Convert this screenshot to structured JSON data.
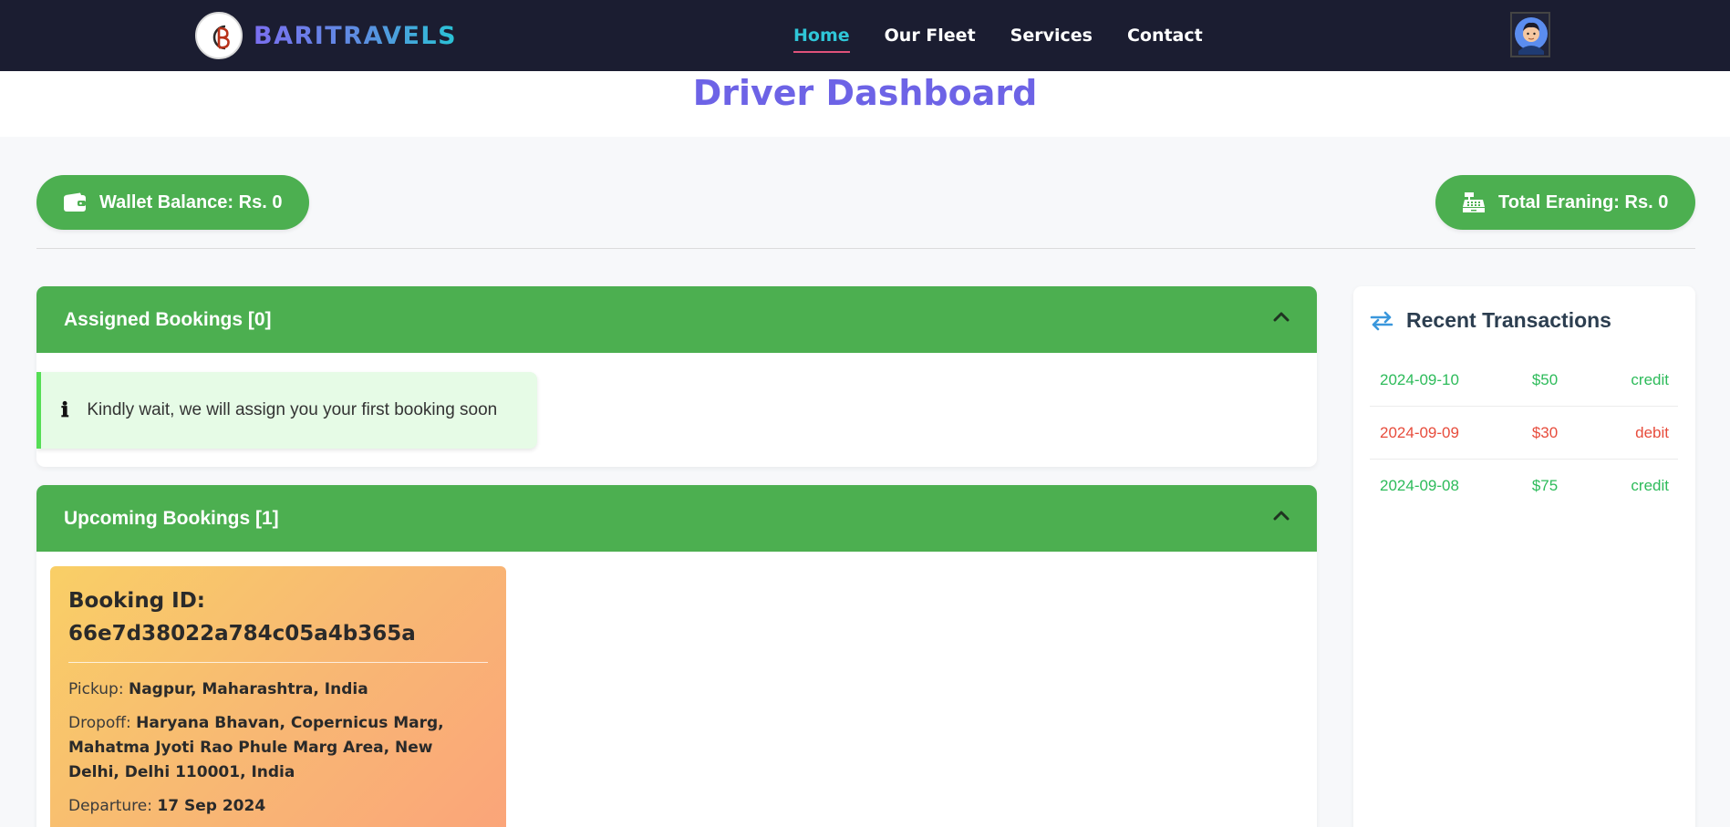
{
  "nav": {
    "brand": "BARITRAVELS",
    "links": [
      "Home",
      "Our Fleet",
      "Services",
      "Contact"
    ]
  },
  "page": {
    "title": "Driver Dashboard"
  },
  "stats": {
    "wallet": "Wallet Balance: Rs. 0",
    "earning": "Total Eraning: Rs. 0"
  },
  "assigned": {
    "header": "Assigned Bookings [0]",
    "notice": "Kindly wait, we will assign you your first booking soon",
    "notice_icon": "ℹ"
  },
  "upcoming": {
    "header": "Upcoming Bookings [1]",
    "booking": {
      "title": "Booking ID: 66e7d38022a784c05a4b365a",
      "pickup_label": "Pickup:",
      "pickup": "Nagpur, Maharashtra, India",
      "dropoff_label": "Dropoff:",
      "dropoff": "Haryana Bhavan, Copernicus Marg, Mahatma Jyoti Rao Phule Marg Area, New Delhi, Delhi 110001, India",
      "departure_label": "Departure:",
      "departure": "17 Sep 2024"
    }
  },
  "transactions": {
    "title": "Recent Transactions",
    "rows": [
      {
        "date": "2024-09-10",
        "amount": "$50",
        "type": "credit"
      },
      {
        "date": "2024-09-09",
        "amount": "$30",
        "type": "debit"
      },
      {
        "date": "2024-09-08",
        "amount": "$75",
        "type": "credit"
      }
    ]
  },
  "colors": {
    "navbar_bg": "#1b1d31",
    "accent_green": "#4caf50",
    "title_purple": "#6d63e6",
    "nav_active": "#2fc6d8",
    "credit": "#2dbb5a",
    "debit": "#e74c3c"
  },
  "icons": [
    "brand-logo",
    "avatar",
    "wallet-icon",
    "cash-register-icon",
    "chevron-up-icon",
    "info-icon",
    "exchange-icon"
  ]
}
